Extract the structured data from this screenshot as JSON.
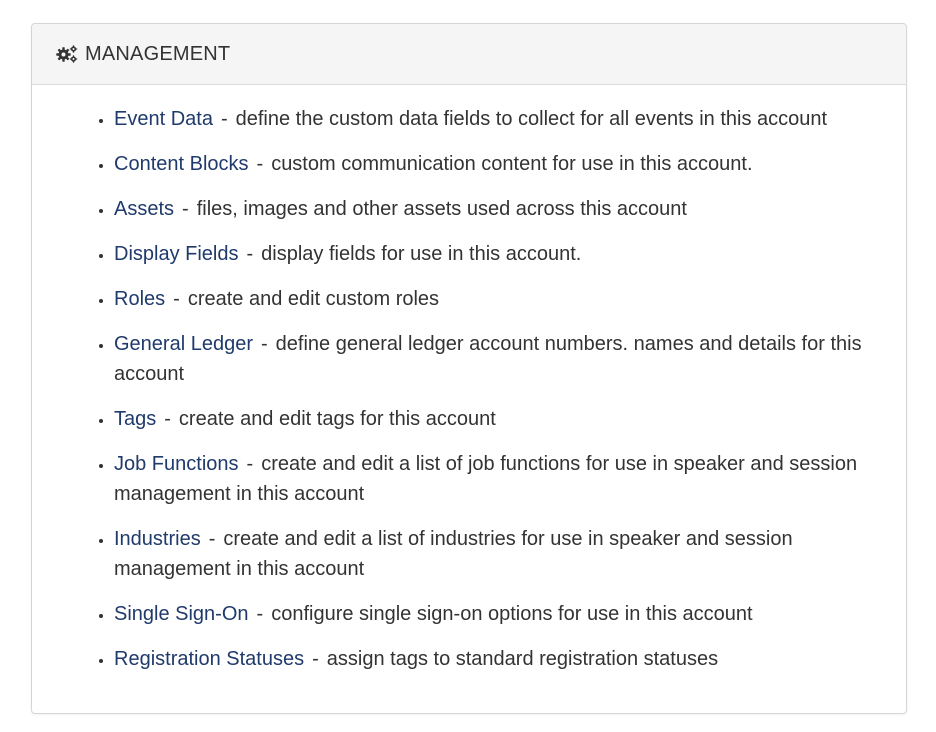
{
  "panel": {
    "title": "MANAGEMENT",
    "icon": "gears-icon"
  },
  "items": [
    {
      "label": "Event Data",
      "description": "define the custom data fields to collect for all events in this account"
    },
    {
      "label": "Content Blocks",
      "description": "custom communication content for use in this account."
    },
    {
      "label": "Assets",
      "description": "files, images and other assets used across this account"
    },
    {
      "label": "Display Fields",
      "description": "display fields for use in this account."
    },
    {
      "label": "Roles",
      "description": "create and edit custom roles"
    },
    {
      "label": "General Ledger",
      "description": "define general ledger account numbers. names and details for this account"
    },
    {
      "label": "Tags",
      "description": "create and edit tags for this account"
    },
    {
      "label": "Job Functions",
      "description": "create and edit a list of job functions for use in speaker and session management in this account"
    },
    {
      "label": "Industries",
      "description": "create and edit a list of industries for use in speaker and session management in this account"
    },
    {
      "label": "Single Sign-On",
      "description": "configure single sign-on options for use in this account"
    },
    {
      "label": "Registration Statuses",
      "description": "assign tags to standard registration statuses"
    }
  ],
  "separator": "-",
  "colors": {
    "link": "#1f3a6b",
    "text": "#333333",
    "heading_bg": "#f5f5f5",
    "border": "#d6d6d6"
  }
}
